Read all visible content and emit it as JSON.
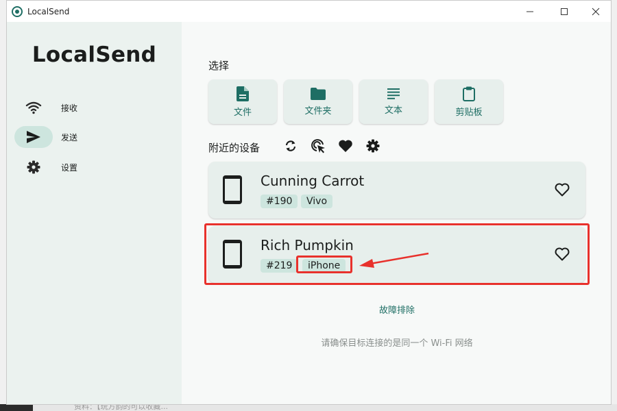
{
  "background": {
    "taskbar_text": "资料：【玩方韵的可以收藏..."
  },
  "window": {
    "title": "LocalSend",
    "controls": {
      "minimize": "minimize-icon",
      "maximize": "maximize-icon",
      "close": "close-icon"
    }
  },
  "sidebar": {
    "brand": "LocalSend",
    "items": [
      {
        "label": "接收",
        "icon": "wifi-icon",
        "active": false
      },
      {
        "label": "发送",
        "icon": "send-icon",
        "active": true
      },
      {
        "label": "设置",
        "icon": "gear-icon",
        "active": false
      }
    ]
  },
  "main": {
    "select_title": "选择",
    "pick_buttons": [
      {
        "label": "文件",
        "icon": "file-icon"
      },
      {
        "label": "文件夹",
        "icon": "folder-icon"
      },
      {
        "label": "文本",
        "icon": "text-icon"
      },
      {
        "label": "剪贴板",
        "icon": "clipboard-icon"
      }
    ],
    "nearby_title": "附近的设备",
    "tools": [
      "refresh-icon",
      "scan-icon",
      "favorites-icon",
      "settings-icon"
    ],
    "devices": [
      {
        "name": "Cunning Carrot",
        "id": "#190",
        "model": "Vivo"
      },
      {
        "name": "Rich Pumpkin",
        "id": "#219",
        "model": "iPhone"
      }
    ],
    "troubleshoot": "故障排除",
    "hint": "请确保目标连接的是同一个 Wi-Fi 网络"
  },
  "colors": {
    "accent": "#1e6e64",
    "sidebar_bg": "#ebf2ef",
    "card_bg": "#e7efec",
    "chip_bg": "#cde5de",
    "annotation": "#e8312c"
  }
}
